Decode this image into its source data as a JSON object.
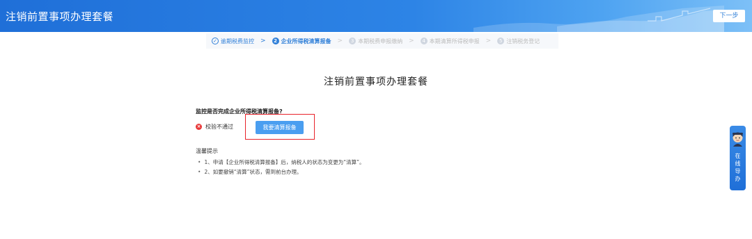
{
  "header": {
    "title": "注销前置事项办理套餐",
    "next_label": "下一步"
  },
  "steps": [
    {
      "num": "✓",
      "label": "逾期税费监控",
      "state": "done"
    },
    {
      "num": "2",
      "label": "企业所得税清算报备",
      "state": "active"
    },
    {
      "num": "3",
      "label": "本期税费申报缴纳",
      "state": "pending"
    },
    {
      "num": "4",
      "label": "本期清算所得税申报",
      "state": "pending"
    },
    {
      "num": "5",
      "label": "注销税务登记",
      "state": "pending"
    }
  ],
  "main": {
    "title": "注销前置事项办理套餐",
    "question": "监控是否完成企业所得税清算报备?",
    "status_text": "校验不通过",
    "button_label": "我要清算报备"
  },
  "tips": {
    "title": "温馨提示",
    "items": [
      "1、申请【企业所得税清算报备】后，纳税人的状态为变更为“清算”。",
      "2、如要撤销“清算”状态，需到前台办理。"
    ]
  },
  "helper": {
    "text": "在线导办"
  },
  "colors": {
    "header_blue": "#1f6fd8",
    "accent_blue": "#2f7fd8",
    "button_blue": "#4a9ef0",
    "error_red": "#e83838",
    "highlight_frame": "#e8222a"
  }
}
